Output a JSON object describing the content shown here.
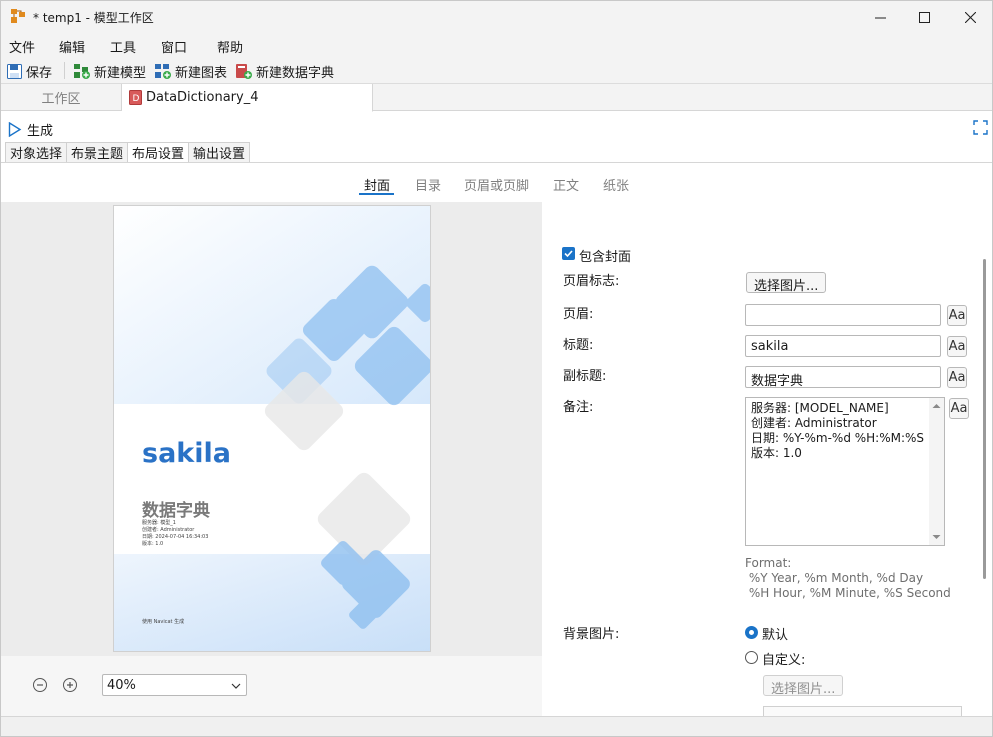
{
  "window": {
    "title": "* temp1 - 模型工作区"
  },
  "menu": [
    "文件",
    "编辑",
    "工具",
    "窗口",
    "帮助"
  ],
  "toolbar": {
    "save": "保存",
    "new_model": "新建模型",
    "new_chart": "新建图表",
    "new_dict": "新建数据字典"
  },
  "doc_tabs": {
    "workspace": "工作区",
    "active": "DataDictionary_4"
  },
  "generate_label": "生成",
  "sub_tabs": [
    "对象选择",
    "布景主题",
    "布局设置",
    "输出设置"
  ],
  "content_tabs": [
    "封面",
    "目录",
    "页眉或页脚",
    "正文",
    "纸张"
  ],
  "preview": {
    "title": "sakila",
    "subtitle": "数据字典",
    "lines": [
      "服务器: 模型_1",
      "创建者: Administrator",
      "日期: 2024-07-04 16:34:03",
      "版本: 1.0"
    ],
    "footer": "使用 Navicat 生成"
  },
  "zoom": {
    "value": "40%"
  },
  "form": {
    "include_cover": "包含封面",
    "header_logo_label": "页眉标志:",
    "choose_image": "选择图片...",
    "header_label": "页眉:",
    "header_value": "",
    "title_label": "标题:",
    "title_value": "sakila",
    "subtitle_label": "副标题:",
    "subtitle_value": "数据字典",
    "notes_label": "备注:",
    "notes_lines": [
      "服务器: [MODEL_NAME]",
      "创建者: Administrator",
      "日期: %Y-%m-%d %H:%M:%S",
      "版本: 1.0"
    ],
    "format_text": "Format:\n %Y Year, %m Month, %d Day\n %H Hour, %M Minute, %S Second",
    "aa": "Aa",
    "bg_label": "背景图片:",
    "bg_default": "默认",
    "bg_custom": "自定义:",
    "bg_choose": "选择图片..."
  },
  "colors": {
    "accent": "#1a73c8",
    "cover_blue": "#2a72c6"
  }
}
